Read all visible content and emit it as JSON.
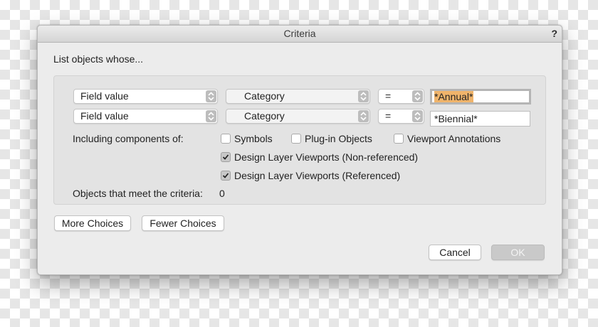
{
  "dialog": {
    "title": "Criteria",
    "help_label": "?",
    "intro_text": "List objects whose..."
  },
  "criteria_rows": [
    {
      "field": "Field value",
      "attribute": "Category",
      "operator": "=",
      "value": "*Annual*",
      "value_selected": true
    },
    {
      "field": "Field value",
      "attribute": "Category",
      "operator": "=",
      "value": "*Biennial*",
      "value_selected": false
    }
  ],
  "components": {
    "label": "Including components of:",
    "options": [
      {
        "label": "Symbols",
        "checked": false
      },
      {
        "label": "Plug-in Objects",
        "checked": false
      },
      {
        "label": "Viewport Annotations",
        "checked": false
      },
      {
        "label": "Design Layer Viewports (Non-referenced)",
        "checked": true
      },
      {
        "label": "Design Layer Viewports (Referenced)",
        "checked": true
      }
    ]
  },
  "result": {
    "label": "Objects that meet the criteria:",
    "count": "0"
  },
  "buttons": {
    "more": "More Choices",
    "fewer": "Fewer Choices",
    "cancel": "Cancel",
    "ok": "OK"
  }
}
